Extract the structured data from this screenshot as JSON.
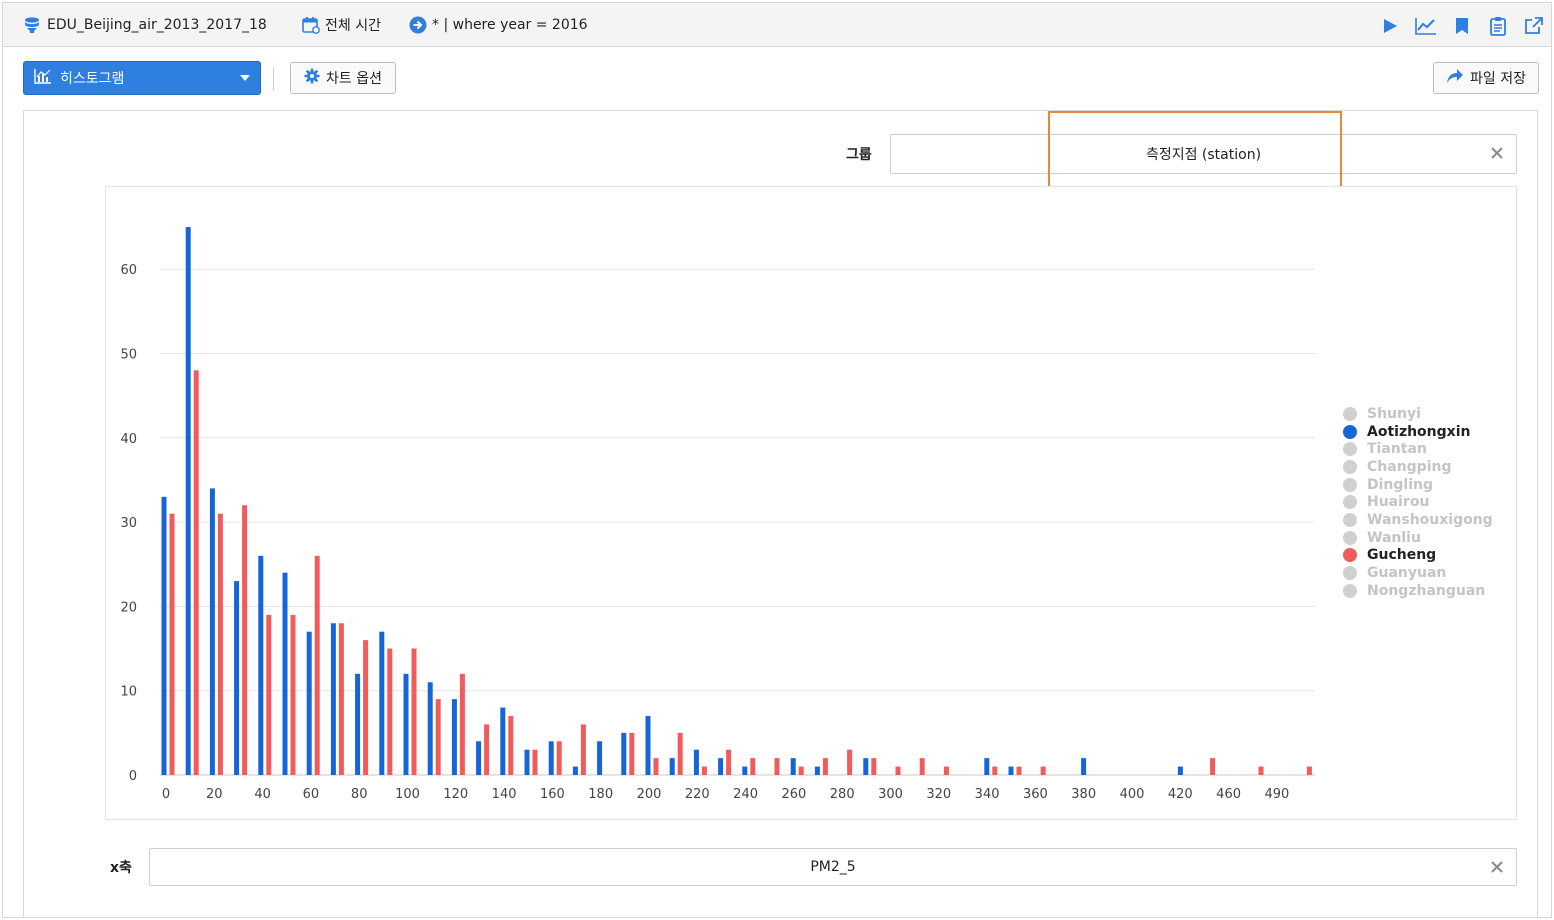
{
  "topbar": {
    "dataset": "EDU_Beijing_air_2013_2017_18",
    "time_range": "전체 시간",
    "query": "* | where year = 2016"
  },
  "toolbar": {
    "chart_type": "히스토그램",
    "chart_options": "차트 옵션",
    "save_file": "파일 저장"
  },
  "controls": {
    "group_label": "그룹",
    "group_value": "측정지점 (station)",
    "x_label": "x축",
    "x_value": "PM2_5"
  },
  "colors": {
    "primary": "#2f7fe0",
    "series_blue": "#1565d8",
    "series_red": "#f25b5b",
    "inactive": "#d0d0d0",
    "highlight_border": "#e8893a"
  },
  "chart_data": {
    "type": "bar",
    "title": "",
    "xlabel": "PM2_5",
    "ylabel": "",
    "ylim": [
      0,
      65
    ],
    "yticks": [
      0,
      10,
      20,
      30,
      40,
      50,
      60
    ],
    "xtick_labels": [
      "0",
      "20",
      "40",
      "60",
      "80",
      "100",
      "120",
      "140",
      "160",
      "180",
      "200",
      "220",
      "240",
      "260",
      "280",
      "300",
      "320",
      "340",
      "360",
      "380",
      "400",
      "420",
      "460",
      "490"
    ],
    "bin_width": 10,
    "grid": true,
    "legend_position": "right",
    "legend": [
      {
        "name": "Shunyi",
        "active": false
      },
      {
        "name": "Aotizhongxin",
        "active": true,
        "color": "#1565d8"
      },
      {
        "name": "Tiantan",
        "active": false
      },
      {
        "name": "Changping",
        "active": false
      },
      {
        "name": "Dingling",
        "active": false
      },
      {
        "name": "Huairou",
        "active": false
      },
      {
        "name": "Wanshouxigong",
        "active": false
      },
      {
        "name": "Wanliu",
        "active": false
      },
      {
        "name": "Gucheng",
        "active": true,
        "color": "#f25b5b"
      },
      {
        "name": "Guanyuan",
        "active": false
      },
      {
        "name": "Nongzhanguan",
        "active": false
      }
    ],
    "series": [
      {
        "name": "Aotizhongxin",
        "color": "#1565d8",
        "points": [
          [
            0,
            33
          ],
          [
            10,
            65
          ],
          [
            20,
            34
          ],
          [
            30,
            23
          ],
          [
            40,
            26
          ],
          [
            50,
            24
          ],
          [
            60,
            17
          ],
          [
            70,
            18
          ],
          [
            80,
            12
          ],
          [
            90,
            17
          ],
          [
            100,
            12
          ],
          [
            110,
            11
          ],
          [
            120,
            9
          ],
          [
            130,
            4
          ],
          [
            140,
            8
          ],
          [
            150,
            3
          ],
          [
            160,
            4
          ],
          [
            170,
            1
          ],
          [
            180,
            4
          ],
          [
            190,
            5
          ],
          [
            200,
            7
          ],
          [
            210,
            2
          ],
          [
            220,
            3
          ],
          [
            230,
            2
          ],
          [
            240,
            1
          ],
          [
            260,
            2
          ],
          [
            270,
            1
          ],
          [
            290,
            2
          ],
          [
            340,
            2
          ],
          [
            350,
            1
          ],
          [
            380,
            2
          ],
          [
            420,
            1
          ]
        ]
      },
      {
        "name": "Gucheng",
        "color": "#f25b5b",
        "points": [
          [
            0,
            31
          ],
          [
            10,
            48
          ],
          [
            20,
            31
          ],
          [
            30,
            32
          ],
          [
            40,
            19
          ],
          [
            50,
            19
          ],
          [
            60,
            26
          ],
          [
            70,
            18
          ],
          [
            80,
            16
          ],
          [
            90,
            15
          ],
          [
            100,
            15
          ],
          [
            110,
            9
          ],
          [
            120,
            12
          ],
          [
            130,
            6
          ],
          [
            140,
            7
          ],
          [
            150,
            3
          ],
          [
            160,
            4
          ],
          [
            170,
            6
          ],
          [
            190,
            5
          ],
          [
            200,
            2
          ],
          [
            210,
            5
          ],
          [
            220,
            1
          ],
          [
            230,
            3
          ],
          [
            240,
            2
          ],
          [
            250,
            2
          ],
          [
            260,
            1
          ],
          [
            270,
            2
          ],
          [
            280,
            3
          ],
          [
            290,
            2
          ],
          [
            300,
            1
          ],
          [
            310,
            2
          ],
          [
            320,
            1
          ],
          [
            340,
            1
          ],
          [
            350,
            1
          ],
          [
            360,
            1
          ],
          [
            430,
            2
          ],
          [
            450,
            1
          ],
          [
            470,
            1
          ]
        ]
      }
    ]
  }
}
